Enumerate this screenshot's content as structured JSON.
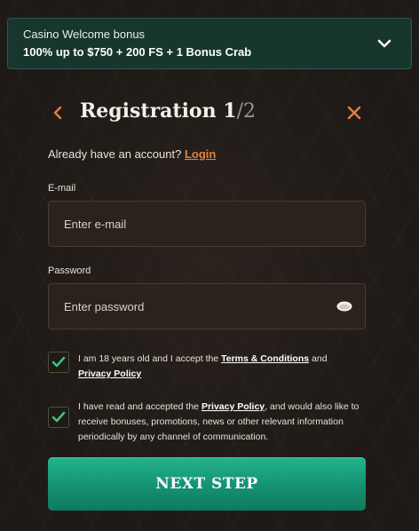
{
  "bonus": {
    "title": "Casino Welcome bonus",
    "offer": "100% up to $750 + 200 FS + 1 Bonus Crab"
  },
  "header": {
    "title": "Registration",
    "step_current": "1",
    "step_total": "/2"
  },
  "account": {
    "prompt": "Already have an account?",
    "login_link": "Login"
  },
  "email": {
    "label": "E-mail",
    "placeholder": "Enter e-mail",
    "value": ""
  },
  "password": {
    "label": "Password",
    "placeholder": "Enter password",
    "value": ""
  },
  "consent_terms": {
    "checked": true,
    "text_before": "I am 18 years old and I accept the ",
    "terms_link": "Terms & Conditions",
    "text_mid": " and ",
    "privacy_link": "Privacy Policy"
  },
  "consent_marketing": {
    "checked": true,
    "text_before": "I have read and accepted the ",
    "privacy_link": "Privacy Policy",
    "text_after": ", and would also like to receive bonuses, promotions, news or other relevant information periodically by any channel of communication."
  },
  "next_button": {
    "label": "NEXT STEP"
  },
  "icons": {
    "expand": "chevron-down-icon",
    "back": "chevron-left-icon",
    "close": "close-icon",
    "reveal_password": "eye-icon",
    "checkmark": "checkmark-icon"
  },
  "colors": {
    "accent_orange": "#e4813d",
    "bonus_bg": "#17362e",
    "button_green": "#159171",
    "check_green": "#3fbf7f",
    "page_bg": "#1f1a17"
  }
}
